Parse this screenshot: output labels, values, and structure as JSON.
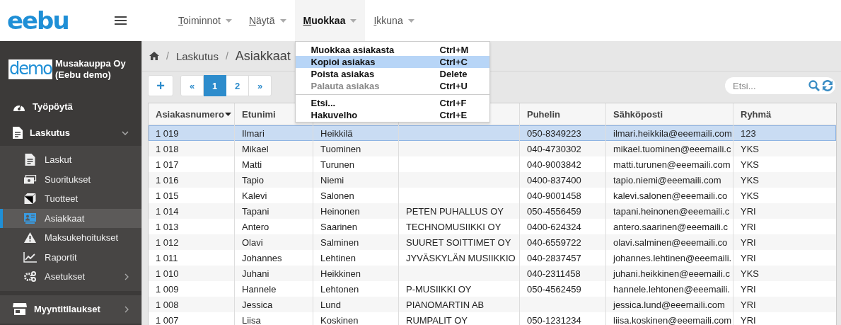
{
  "logo": "eebu",
  "menubar": [
    {
      "label": "Toiminnot",
      "open": false
    },
    {
      "label": "Näytä",
      "open": false
    },
    {
      "label": "Muokkaa",
      "open": true
    },
    {
      "label": "Ikkuna",
      "open": false
    }
  ],
  "dropdown": [
    {
      "kind": "item",
      "label": "Muokkaa asiakasta",
      "shortcut": "Ctrl+M",
      "selected": false,
      "disabled": false
    },
    {
      "kind": "item",
      "label": "Kopioi asiakas",
      "shortcut": "Ctrl+C",
      "selected": true,
      "disabled": false
    },
    {
      "kind": "item",
      "label": "Poista asiakas",
      "shortcut": "Delete",
      "selected": false,
      "disabled": false
    },
    {
      "kind": "item",
      "label": "Palauta asiakas",
      "shortcut": "Ctrl+U",
      "selected": false,
      "disabled": true
    },
    {
      "kind": "separator"
    },
    {
      "kind": "item",
      "label": "Etsi...",
      "shortcut": "Ctrl+F",
      "selected": false,
      "disabled": false
    },
    {
      "kind": "item",
      "label": "Hakuvelho",
      "shortcut": "Ctrl+E",
      "selected": false,
      "disabled": false
    }
  ],
  "sidebar": {
    "company": {
      "logo": "demo",
      "name": "Musakauppa Oy (Eebu demo)"
    },
    "items": [
      {
        "label": "Työpöytä",
        "selected": false
      },
      {
        "label": "Laskutus",
        "selected": false,
        "expanded": true,
        "children": [
          {
            "label": "Laskut",
            "selected": false
          },
          {
            "label": "Suoritukset",
            "selected": false
          },
          {
            "label": "Tuotteet",
            "selected": false
          },
          {
            "label": "Asiakkaat",
            "selected": true
          },
          {
            "label": "Maksukehoitukset",
            "selected": false
          },
          {
            "label": "Raportit",
            "selected": false
          },
          {
            "label": "Asetukset",
            "selected": false,
            "expanded": false
          }
        ]
      },
      {
        "label": "Myyntitilaukset",
        "selected": false,
        "expanded": false
      }
    ]
  },
  "breadcrumb": [
    {
      "kind": "home"
    },
    {
      "kind": "separator",
      "text": "/"
    },
    {
      "kind": "link",
      "text": "Laskutus"
    },
    {
      "kind": "separator",
      "text": "/"
    },
    {
      "kind": "current",
      "text": "Asiakkaat"
    }
  ],
  "toolbar": {
    "add_button": "+",
    "pagination": [
      {
        "label": "«",
        "selected": false
      },
      {
        "label": "1",
        "selected": true
      },
      {
        "label": "2",
        "selected": false
      },
      {
        "label": "»",
        "selected": false
      }
    ],
    "search": {
      "placeholder": "Etsi..."
    }
  },
  "table": {
    "columns": [
      {
        "label": "Asiakasnumero",
        "sorted": true
      },
      {
        "label": "Etunimi",
        "sorted": false
      },
      null,
      null,
      {
        "label": "Puhelin",
        "sorted": false
      },
      {
        "label": "Sähköposti",
        "sorted": false
      },
      {
        "label": "Ryhmä",
        "sorted": false
      }
    ],
    "rows": [
      {
        "selected": true,
        "cells": [
          "1 019",
          "Ilmari",
          "Heikkilä",
          null,
          "050-8349223",
          "ilmari.heikkila@eeemaili.com",
          "123"
        ]
      },
      {
        "selected": false,
        "cells": [
          "1 018",
          "Mikael",
          "Tuominen",
          null,
          "040-4730302",
          "mikael.tuominen@eeemaili.c",
          "YKS"
        ]
      },
      {
        "selected": false,
        "cells": [
          "1 017",
          "Matti",
          "Turunen",
          null,
          "040-9003842",
          "matti.turunen@eeemaili.com",
          "YKS"
        ]
      },
      {
        "selected": false,
        "cells": [
          "1 016",
          "Tapio",
          "Niemi",
          null,
          "0400-837400",
          "tapio.niemi@eeemaili.com",
          "YKS"
        ]
      },
      {
        "selected": false,
        "cells": [
          "1 015",
          "Kalevi",
          "Salonen",
          null,
          "040-9001458",
          "kalevi.salonen@eeemaili.co",
          "YKS"
        ]
      },
      {
        "selected": false,
        "cells": [
          "1 014",
          "Tapani",
          "Heinonen",
          "PETEN PUHALLUS OY",
          "050-4556459",
          "tapani.heinonen@eeemaili.c",
          "YRI"
        ]
      },
      {
        "selected": false,
        "cells": [
          "1 013",
          "Antero",
          "Saarinen",
          "TECHNOMUSIIKKI OY",
          "0400-624324",
          "antero.saarinen@eeemaili.c",
          "YRI"
        ]
      },
      {
        "selected": false,
        "cells": [
          "1 012",
          "Olavi",
          "Salminen",
          "SUURET SOITTIMET OY",
          "040-6559722",
          "olavi.salminen@eeemaili.co",
          "YRI"
        ]
      },
      {
        "selected": false,
        "cells": [
          "1 011",
          "Johannes",
          "Lehtinen",
          "JYVÄSKYLÄN MUSIIKKIO",
          "040-2837457",
          "johannes.lehtinen@eeemaili.",
          "YRI"
        ]
      },
      {
        "selected": false,
        "cells": [
          "1 010",
          "Juhani",
          "Heikkinen",
          null,
          "040-2311458",
          "juhani.heikkinen@eeemaili.c",
          "YKS"
        ]
      },
      {
        "selected": false,
        "cells": [
          "1 009",
          "Hannele",
          "Lehtonen",
          "P-MUSIIKKI OY",
          "050-4562459",
          "hannele.lehtonen@eeemaili.",
          "YRI"
        ]
      },
      {
        "selected": false,
        "cells": [
          "1 008",
          "Jessica",
          "Lund",
          "PIANOMARTIN AB",
          null,
          "jessica.lund@eeemaili.com",
          "YRI"
        ]
      },
      {
        "selected": false,
        "cells": [
          "1 007",
          "Liisa",
          "Koskinen",
          "RUMPALIT OY",
          "050-1231234",
          "liisa.koskinen@eeemaili.com",
          "YRI"
        ]
      }
    ]
  }
}
